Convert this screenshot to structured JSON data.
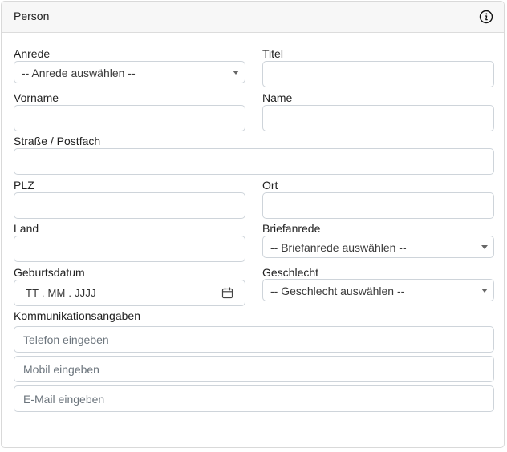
{
  "panel": {
    "title": "Person"
  },
  "labels": {
    "anrede": "Anrede",
    "titel": "Titel",
    "vorname": "Vorname",
    "name": "Name",
    "strasse": "Straße / Postfach",
    "plz": "PLZ",
    "ort": "Ort",
    "land": "Land",
    "briefanrede": "Briefanrede",
    "geburtsdatum": "Geburtsdatum",
    "geschlecht": "Geschlecht",
    "kommunikation": "Kommunikationsangaben"
  },
  "selects": {
    "anrede": "-- Anrede auswählen --",
    "briefanrede": "-- Briefanrede auswählen --",
    "geschlecht": "-- Geschlecht auswählen --"
  },
  "date": {
    "placeholder": "TT . MM . JJJJ"
  },
  "kommunikation": {
    "telefon_placeholder": "Telefon eingeben",
    "mobil_placeholder": "Mobil eingeben",
    "email_placeholder": "E-Mail eingeben"
  },
  "icons": {
    "info": "info-icon",
    "calendar": "calendar-icon",
    "dropdown": "chevron-down-icon"
  },
  "colors": {
    "header_bg": "#f7f7f7",
    "border": "#ced4da",
    "text": "#212529"
  }
}
